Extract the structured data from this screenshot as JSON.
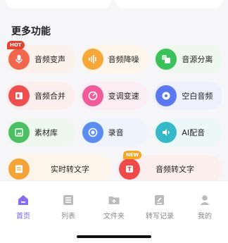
{
  "section": {
    "title": "更多功能"
  },
  "features": [
    {
      "label": "音频变声",
      "icon": "microphone-icon",
      "color": "#f2664e",
      "bg": "#fdf1eb",
      "badge": "HOT"
    },
    {
      "label": "音频降噪",
      "icon": "waveform-icon",
      "color": "#f5a73a",
      "bg": "#fdf5ea"
    },
    {
      "label": "音源分离",
      "icon": "split-squares-icon",
      "color": "#3cc05a",
      "bg": "#eef8ef"
    },
    {
      "label": "音频合并",
      "icon": "merge-icon",
      "color": "#ef4f4f",
      "bg": "#fdeeee"
    },
    {
      "label": "变调变速",
      "icon": "speed-dial-icon",
      "color": "#f25a9a",
      "bg": "#fdeef4"
    },
    {
      "label": "空白音频",
      "icon": "blank-audio-icon",
      "color": "#5b78f0",
      "bg": "#eef1fd"
    },
    {
      "label": "素材库",
      "icon": "library-icon",
      "color": "#4cbf62",
      "bg": "#eef8ef"
    },
    {
      "label": "录音",
      "icon": "record-icon",
      "color": "#5b8df0",
      "bg": "#eef3fd"
    },
    {
      "label": "AI配音",
      "icon": "speaker-icon",
      "color": "#35b9c9",
      "bg": "#ecf7f8"
    },
    {
      "label": "实时转文字",
      "icon": "realtime-text-icon",
      "color": "#f5a43a",
      "bg": "#fdf4ea"
    },
    {
      "label": "音频转文字",
      "icon": "audio-to-text-icon",
      "color": "#ef4a4a",
      "bg": "#fdeeee",
      "badge": "NEW"
    }
  ],
  "tabbar": {
    "items": [
      {
        "label": "首页",
        "icon": "home-icon",
        "active": true
      },
      {
        "label": "列表",
        "icon": "list-icon"
      },
      {
        "label": "文件夹",
        "icon": "folder-icon"
      },
      {
        "label": "转写记录",
        "icon": "edit-record-icon"
      },
      {
        "label": "我的",
        "icon": "profile-icon"
      }
    ]
  },
  "colors": {
    "accent": "#7b5cf0",
    "hot_badge": "#e8412f",
    "new_badge": "#f5a623"
  }
}
